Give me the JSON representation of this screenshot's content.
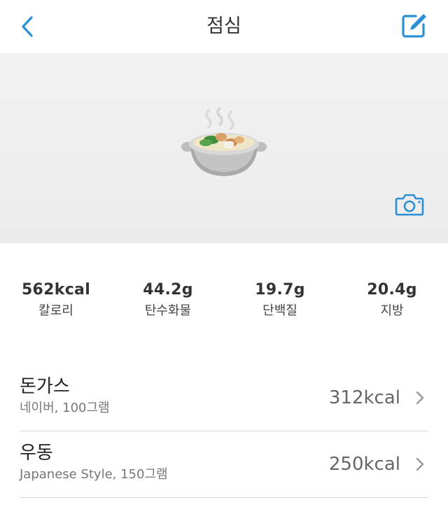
{
  "header": {
    "title": "점심",
    "back_icon": "chevron-left-icon",
    "edit_icon": "edit-icon",
    "accent_color": "#2a8fd4"
  },
  "hero": {
    "food_icon": "hot-pot-emoji",
    "camera_icon": "camera-icon"
  },
  "nutrition": [
    {
      "value": "562kcal",
      "label": "칼로리"
    },
    {
      "value": "44.2g",
      "label": "탄수화물"
    },
    {
      "value": "19.7g",
      "label": "단백질"
    },
    {
      "value": "20.4g",
      "label": "지방"
    }
  ],
  "foods": [
    {
      "name": "돈가스",
      "detail": "네이버, 100그램",
      "kcal": "312kcal"
    },
    {
      "name": "우동",
      "detail": "Japanese Style, 150그램",
      "kcal": "250kcal"
    }
  ]
}
